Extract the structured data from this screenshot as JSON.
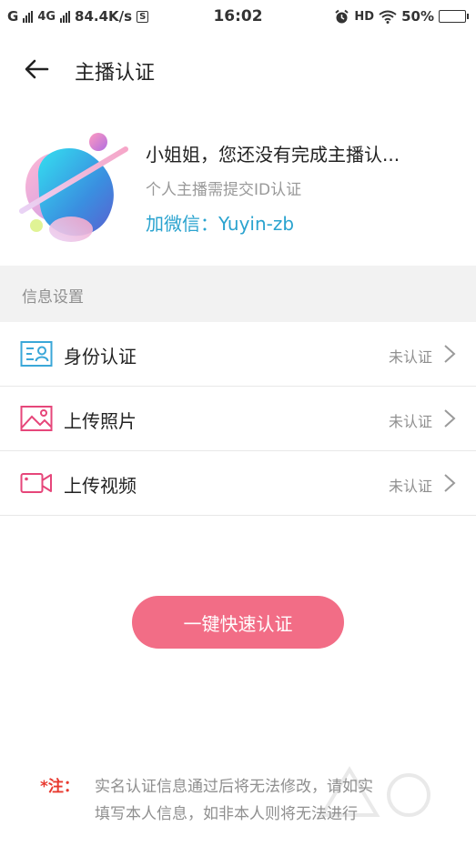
{
  "status_bar": {
    "carrier1": "G",
    "carrier2": "4G",
    "speed": "84.4K/s",
    "speed_badge": "S",
    "time": "16:02",
    "hd": "HD",
    "battery": "50%",
    "battery_level": 0.5
  },
  "header": {
    "title": "主播认证",
    "back_icon": "arrow-left-icon"
  },
  "profile": {
    "title": "小姐姐，您还没有完成主播认...",
    "subtitle": "个人主播需提交ID认证",
    "wechat_label": "加微信：",
    "wechat_id": "Yuyin-zb"
  },
  "section": {
    "title": "信息设置"
  },
  "items": [
    {
      "label": "身份认证",
      "status": "未认证",
      "icon": "id-card-icon"
    },
    {
      "label": "上传照片",
      "status": "未认证",
      "icon": "image-icon"
    },
    {
      "label": "上传视频",
      "status": "未认证",
      "icon": "video-camera-icon"
    }
  ],
  "button": {
    "label": "一键快速认证"
  },
  "note": {
    "mark": "*注：",
    "line1": "实名认证信息通过后将无法修改，请如实",
    "line2": "填写本人信息，如非本人则将无法进行"
  },
  "colors": {
    "accent": "#f26d86",
    "link": "#2aa3cf",
    "note_mark": "#e8392f",
    "icon_blue": "#3aa7d8",
    "icon_pink": "#e6467a"
  }
}
